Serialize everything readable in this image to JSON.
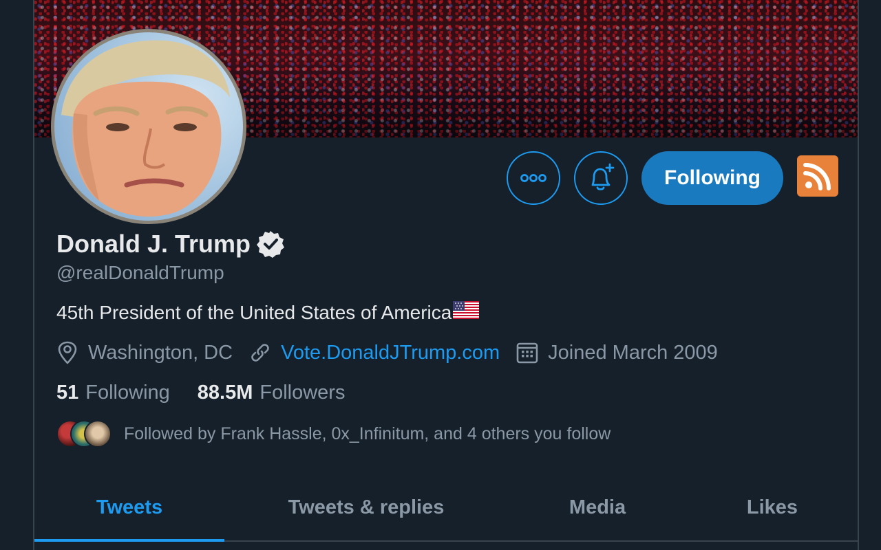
{
  "profile": {
    "display_name": "Donald J. Trump",
    "handle": "@realDonaldTrump",
    "bio": "45th President of the United States of America",
    "location": "Washington, DC",
    "website": "Vote.DonaldJTrump.com",
    "joined": "Joined March 2009",
    "verified": true
  },
  "stats": {
    "following_count": "51",
    "following_label": "Following",
    "followers_count": "88.5M",
    "followers_label": "Followers"
  },
  "followed_by": {
    "text": "Followed by Frank Hassle, 0x_Infinitum, and 4 others you follow"
  },
  "actions": {
    "following_button": "Following"
  },
  "tabs": [
    {
      "label": "Tweets",
      "active": true
    },
    {
      "label": "Tweets & replies",
      "active": false
    },
    {
      "label": "Media",
      "active": false
    },
    {
      "label": "Likes",
      "active": false
    }
  ],
  "icons": {
    "more": "more-options-icon",
    "notify": "notification-bell-plus-icon",
    "rss": "rss-feed-icon",
    "verified": "verified-badge-icon",
    "location": "location-pin-icon",
    "link": "link-icon",
    "calendar": "calendar-icon",
    "flag": "us-flag-icon"
  },
  "colors": {
    "background": "#15202b",
    "accent": "#1d9bf0",
    "following_button": "#1a7abf",
    "rss": "#e8823a",
    "text_primary": "#e7e9ea",
    "text_secondary": "#8b98a5"
  }
}
